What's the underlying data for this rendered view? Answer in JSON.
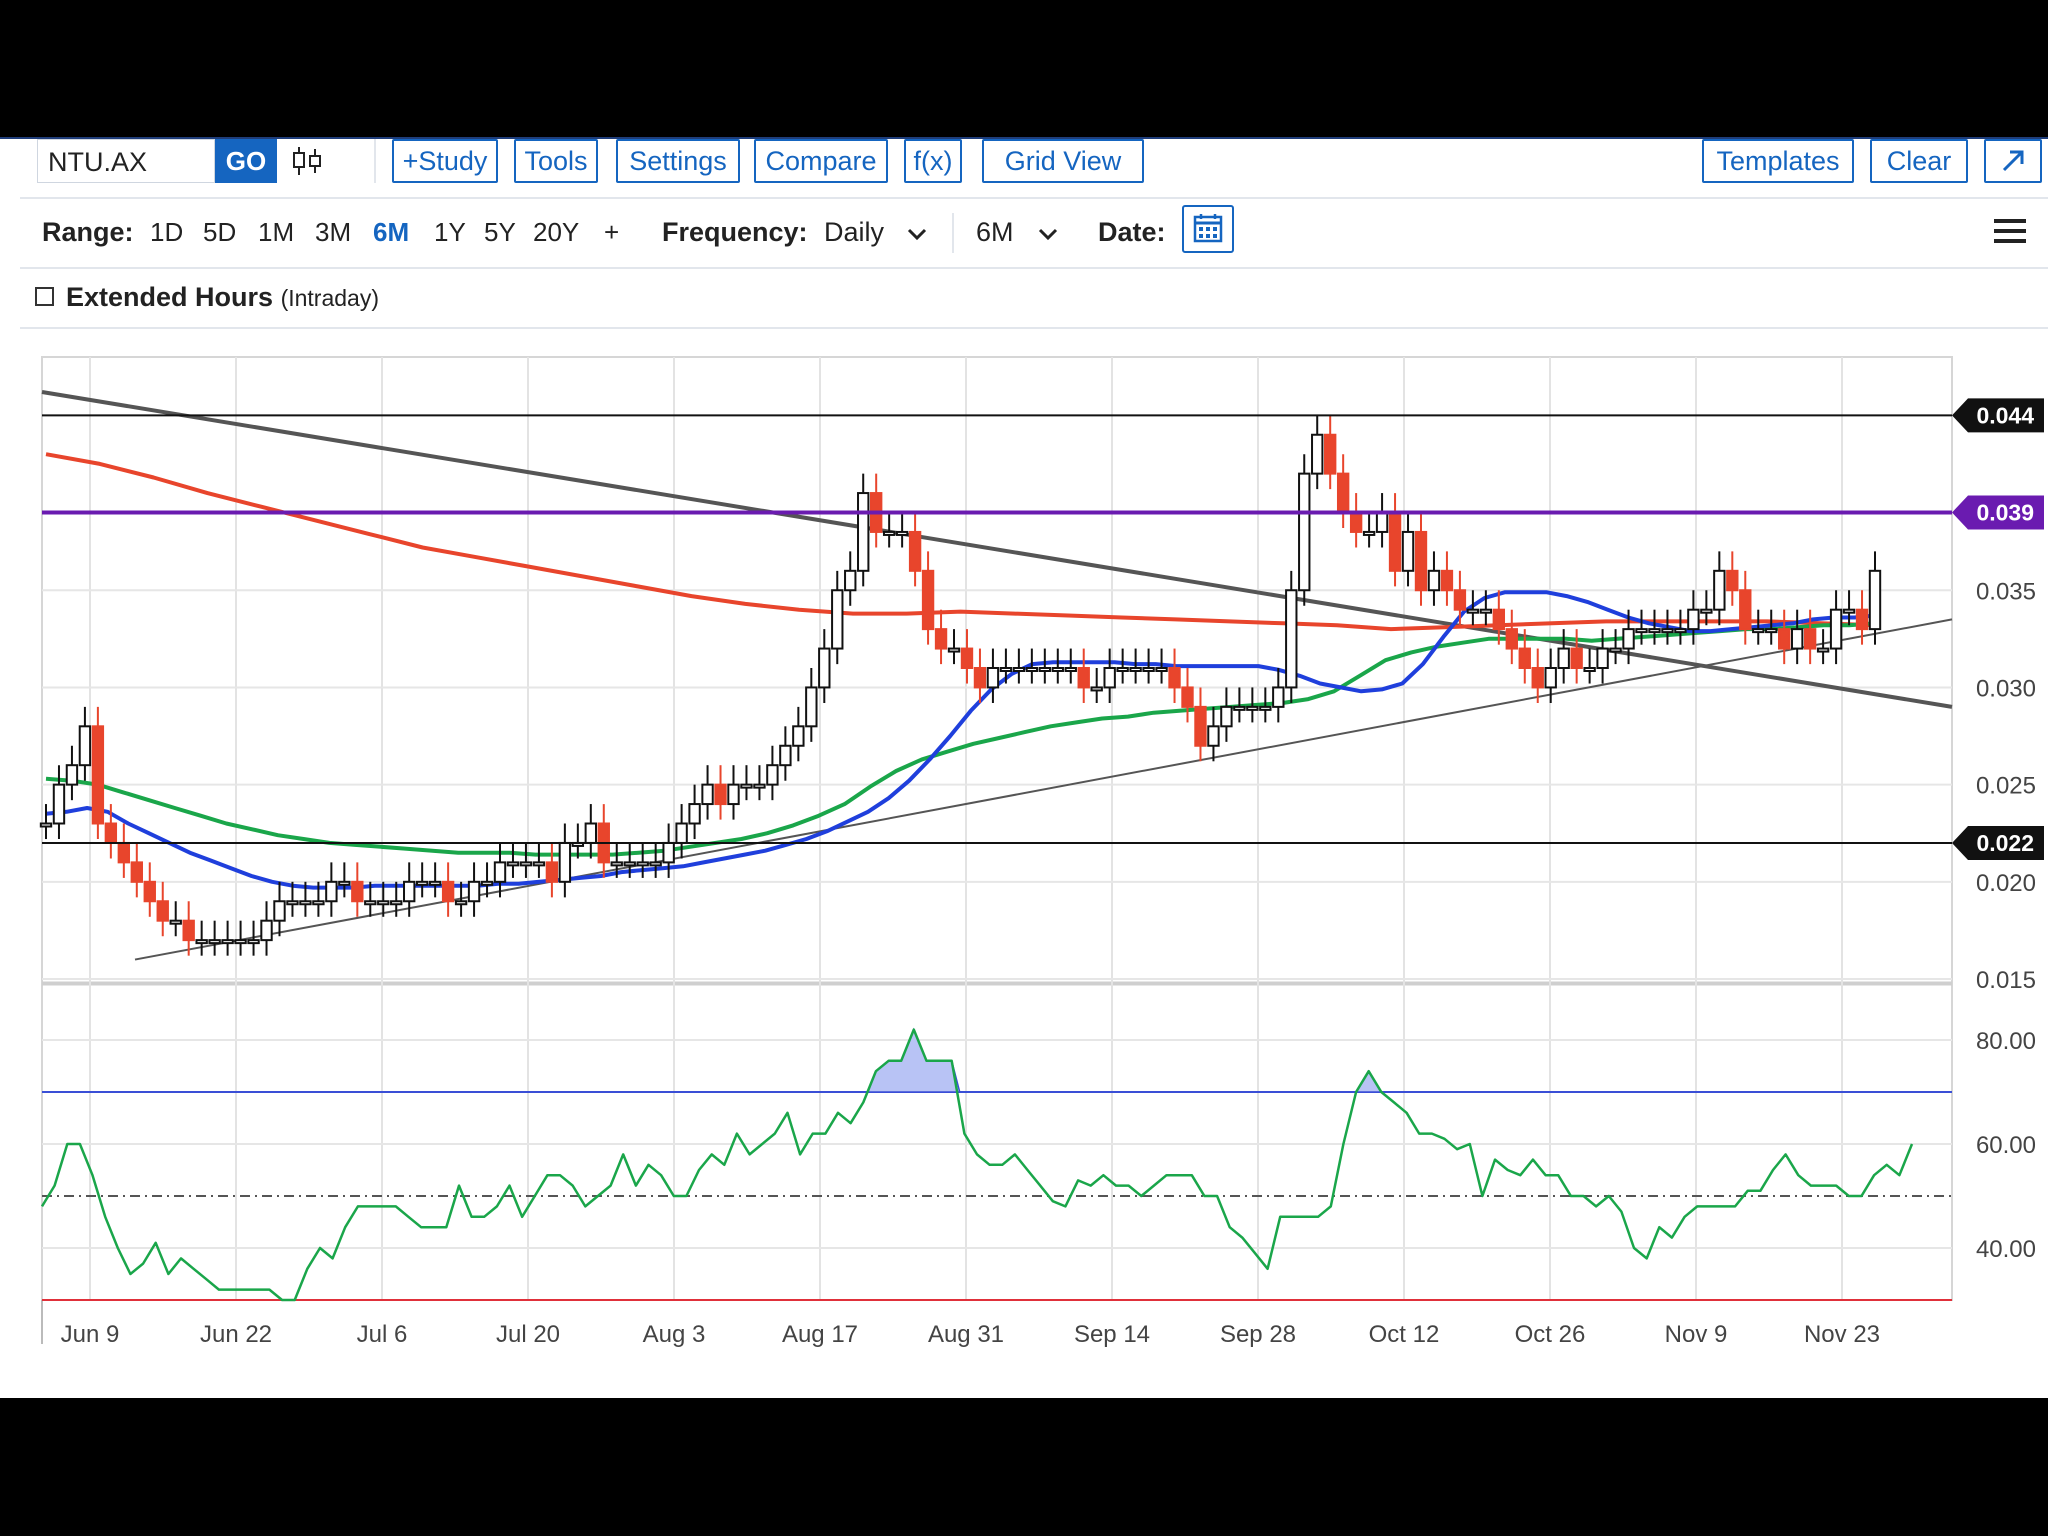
{
  "toolbar": {
    "symbol": "NTU.AX",
    "go_label": "GO",
    "buttons": [
      "+Study",
      "Tools",
      "Settings",
      "Compare",
      "f(x)",
      "Grid View"
    ],
    "templates_label": "Templates",
    "clear_label": "Clear"
  },
  "range_bar": {
    "range_label": "Range:",
    "ranges": [
      "1D",
      "5D",
      "1M",
      "3M",
      "6M",
      "1Y",
      "5Y",
      "20Y",
      "+"
    ],
    "active_range": "6M",
    "frequency_label": "Frequency:",
    "frequency_value": "Daily",
    "period_value": "6M",
    "date_label": "Date:"
  },
  "extended": {
    "label": "Extended Hours",
    "sublabel": "(Intraday)",
    "checked": false
  },
  "colors": {
    "up_candle": "#ffffff",
    "down_candle": "#e8452c",
    "ma_short": "#1f3fdc",
    "ma_mid": "#1aa64a",
    "ma_long": "#e8452c",
    "rsi": "#1aa64a",
    "resistance_purple": "#6a1bb0"
  },
  "chart_data": [
    {
      "type": "line",
      "title": "",
      "ylabel": "",
      "ylim": [
        0.015,
        0.047
      ],
      "ticks_y": [
        "0.015",
        "0.020",
        "0.025",
        "0.030",
        "0.035"
      ],
      "x_ticks": [
        "Jun 9",
        "Jun 22",
        "Jul 6",
        "Jul 20",
        "Aug 3",
        "Aug 17",
        "Aug 31",
        "Sep 14",
        "Sep 28",
        "Oct 12",
        "Oct 26",
        "Nov 9",
        "Nov 23"
      ],
      "horizontal_levels": [
        {
          "label": "0.044",
          "value": 0.044,
          "color": "#111111"
        },
        {
          "label": "0.039",
          "value": 0.039,
          "color": "#6a1bb0"
        },
        {
          "label": "0.022",
          "value": 0.022,
          "color": "#111111"
        }
      ],
      "closes": [
        0.023,
        0.025,
        0.026,
        0.028,
        0.023,
        0.022,
        0.021,
        0.02,
        0.019,
        0.018,
        0.018,
        0.017,
        0.017,
        0.017,
        0.017,
        0.017,
        0.017,
        0.018,
        0.019,
        0.019,
        0.019,
        0.019,
        0.02,
        0.02,
        0.019,
        0.019,
        0.019,
        0.019,
        0.02,
        0.02,
        0.02,
        0.019,
        0.019,
        0.02,
        0.02,
        0.021,
        0.021,
        0.021,
        0.021,
        0.02,
        0.022,
        0.022,
        0.023,
        0.021,
        0.021,
        0.021,
        0.021,
        0.021,
        0.022,
        0.023,
        0.024,
        0.025,
        0.024,
        0.025,
        0.025,
        0.025,
        0.026,
        0.027,
        0.028,
        0.03,
        0.032,
        0.035,
        0.036,
        0.04,
        0.038,
        0.038,
        0.038,
        0.036,
        0.033,
        0.032,
        0.032,
        0.031,
        0.03,
        0.031,
        0.031,
        0.031,
        0.031,
        0.031,
        0.031,
        0.031,
        0.03,
        0.03,
        0.031,
        0.031,
        0.031,
        0.031,
        0.031,
        0.03,
        0.029,
        0.027,
        0.028,
        0.029,
        0.029,
        0.029,
        0.029,
        0.03,
        0.035,
        0.041,
        0.043,
        0.041,
        0.039,
        0.038,
        0.038,
        0.039,
        0.036,
        0.038,
        0.035,
        0.036,
        0.035,
        0.034,
        0.034,
        0.034,
        0.033,
        0.032,
        0.031,
        0.03,
        0.031,
        0.032,
        0.031,
        0.031,
        0.032,
        0.032,
        0.033,
        0.033,
        0.033,
        0.033,
        0.033,
        0.034,
        0.034,
        0.036,
        0.035,
        0.033,
        0.033,
        0.033,
        0.032,
        0.033,
        0.032,
        0.032,
        0.034,
        0.034,
        0.033,
        0.036
      ],
      "series": [
        {
          "name": "",
          "values": [
            0.0235,
            0.0236,
            0.0238,
            0.0236,
            0.023,
            0.0225,
            0.022,
            0.0215,
            0.0211,
            0.0207,
            0.0203,
            0.02,
            0.0198,
            0.0197,
            0.0197,
            0.0197,
            0.0198,
            0.0198,
            0.0198,
            0.0198,
            0.0198,
            0.0198,
            0.0199,
            0.0199,
            0.02,
            0.0201,
            0.0202,
            0.0203,
            0.0205,
            0.0206,
            0.0207,
            0.0208,
            0.021,
            0.0212,
            0.0214,
            0.0216,
            0.0219,
            0.0222,
            0.0226,
            0.0231,
            0.0236,
            0.0243,
            0.0252,
            0.0263,
            0.0275,
            0.0288,
            0.0299,
            0.0307,
            0.0312,
            0.0313,
            0.0313,
            0.0313,
            0.0313,
            0.0312,
            0.0312,
            0.0311,
            0.0311,
            0.0311,
            0.0311,
            0.0311,
            0.0309,
            0.0306,
            0.0302,
            0.03,
            0.0298,
            0.0299,
            0.0302,
            0.0312,
            0.0326,
            0.0339,
            0.0346,
            0.0349,
            0.0349,
            0.0349,
            0.0347,
            0.0344,
            0.034,
            0.0336,
            0.0333,
            0.0331,
            0.0329,
            0.0329,
            0.033,
            0.0331,
            0.0332,
            0.0333,
            0.0335,
            0.0336,
            0.0336,
            0.0337
          ]
        },
        {
          "name": "",
          "values": [
            0.0253,
            0.0252,
            0.025,
            0.0246,
            0.0242,
            0.0238,
            0.0234,
            0.023,
            0.0227,
            0.0224,
            0.0222,
            0.022,
            0.0219,
            0.0218,
            0.0217,
            0.0216,
            0.0215,
            0.0215,
            0.0215,
            0.0214,
            0.0214,
            0.0214,
            0.0214,
            0.0215,
            0.0216,
            0.0218,
            0.022,
            0.0222,
            0.0225,
            0.0229,
            0.0234,
            0.024,
            0.0249,
            0.0257,
            0.0263,
            0.0267,
            0.0271,
            0.0274,
            0.0277,
            0.028,
            0.0282,
            0.0284,
            0.0285,
            0.0287,
            0.0288,
            0.0289,
            0.029,
            0.0291,
            0.0292,
            0.0294,
            0.0298,
            0.0306,
            0.0314,
            0.0318,
            0.0321,
            0.0323,
            0.0325,
            0.0325,
            0.0325,
            0.0325,
            0.0324,
            0.0325,
            0.0326,
            0.0327,
            0.0328,
            0.0329,
            0.033,
            0.033,
            0.0331,
            0.0332,
            0.0332,
            0.0333
          ]
        },
        {
          "name": "",
          "values": [
            0.042,
            0.0415,
            0.0408,
            0.04,
            0.0393,
            0.0386,
            0.0379,
            0.0372,
            0.0367,
            0.0362,
            0.0357,
            0.0352,
            0.0347,
            0.0343,
            0.034,
            0.0338,
            0.0338,
            0.0339,
            0.0338,
            0.0337,
            0.0336,
            0.0335,
            0.0334,
            0.0333,
            0.0332,
            0.033,
            0.0331,
            0.0332,
            0.0333,
            0.0334,
            0.0334,
            0.0334,
            0.0334,
            0.0333,
            0.0332
          ]
        }
      ],
      "trendlines": [
        "falling resistance",
        "rising support"
      ]
    },
    {
      "type": "line",
      "title": "",
      "ylim": [
        30,
        90
      ],
      "ticks_y": [
        "40.00",
        "60.00",
        "80.00"
      ],
      "levels": [
        70,
        50,
        30
      ],
      "series": [
        {
          "name": "",
          "values": [
            48,
            52,
            60,
            60,
            54,
            46,
            40,
            35,
            37,
            41,
            35,
            38,
            36,
            34,
            32,
            32,
            32,
            32,
            32,
            30,
            30,
            36,
            40,
            38,
            44,
            48,
            48,
            48,
            48,
            46,
            44,
            44,
            44,
            52,
            46,
            46,
            48,
            52,
            46,
            50,
            54,
            54,
            52,
            48,
            50,
            52,
            58,
            52,
            56,
            54,
            50,
            50,
            55,
            58,
            56,
            62,
            58,
            60,
            62,
            66,
            58,
            62,
            62,
            66,
            64,
            68,
            74,
            76,
            76,
            82,
            76,
            76,
            76,
            62,
            58,
            56,
            56,
            58,
            55,
            52,
            49,
            48,
            53,
            52,
            54,
            52,
            52,
            50,
            52,
            54,
            54,
            54,
            50,
            50,
            44,
            42,
            39,
            36,
            46,
            46,
            46,
            46,
            48,
            60,
            70,
            74,
            70,
            68,
            66,
            62,
            62,
            61,
            59,
            60,
            50,
            57,
            55,
            54,
            57,
            54,
            54,
            50,
            50,
            48,
            50,
            47,
            40,
            38,
            44,
            42,
            46,
            48,
            48,
            48,
            48,
            51,
            51,
            55,
            58,
            54,
            52,
            52,
            52,
            50,
            50,
            54,
            56,
            54,
            60
          ]
        }
      ]
    }
  ]
}
